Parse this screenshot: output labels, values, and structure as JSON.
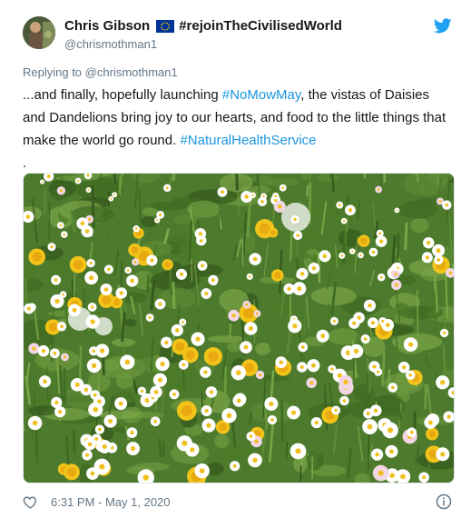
{
  "tweet": {
    "author": {
      "display_name": "Chris Gibson",
      "name_suffix": "#rejoinTheCivilisedWorld",
      "handle": "@chrismothman1",
      "flag_icon": "eu-flag-icon"
    },
    "replying_prefix": "Replying to",
    "replying_to": "@chrismothman1",
    "text_parts": {
      "p1": "...and finally, hopefully launching ",
      "hashtag1": "#NoMowMay",
      "p2": ", the vistas of Daisies and Dandelions bring joy to our hearts, and food to the little things that make the world go round. ",
      "hashtag2": "#NaturalHealthService",
      "p3": "."
    },
    "media_icon": "meadow-photo",
    "timestamp": "6:31 PM - May 1, 2020",
    "icons": {
      "brand": "twitter-bird-icon",
      "like": "heart-icon",
      "info": "info-icon"
    },
    "colors": {
      "hashtag": "#1b95e0",
      "brand": "#1da1f2",
      "secondary_text": "#657786"
    }
  }
}
